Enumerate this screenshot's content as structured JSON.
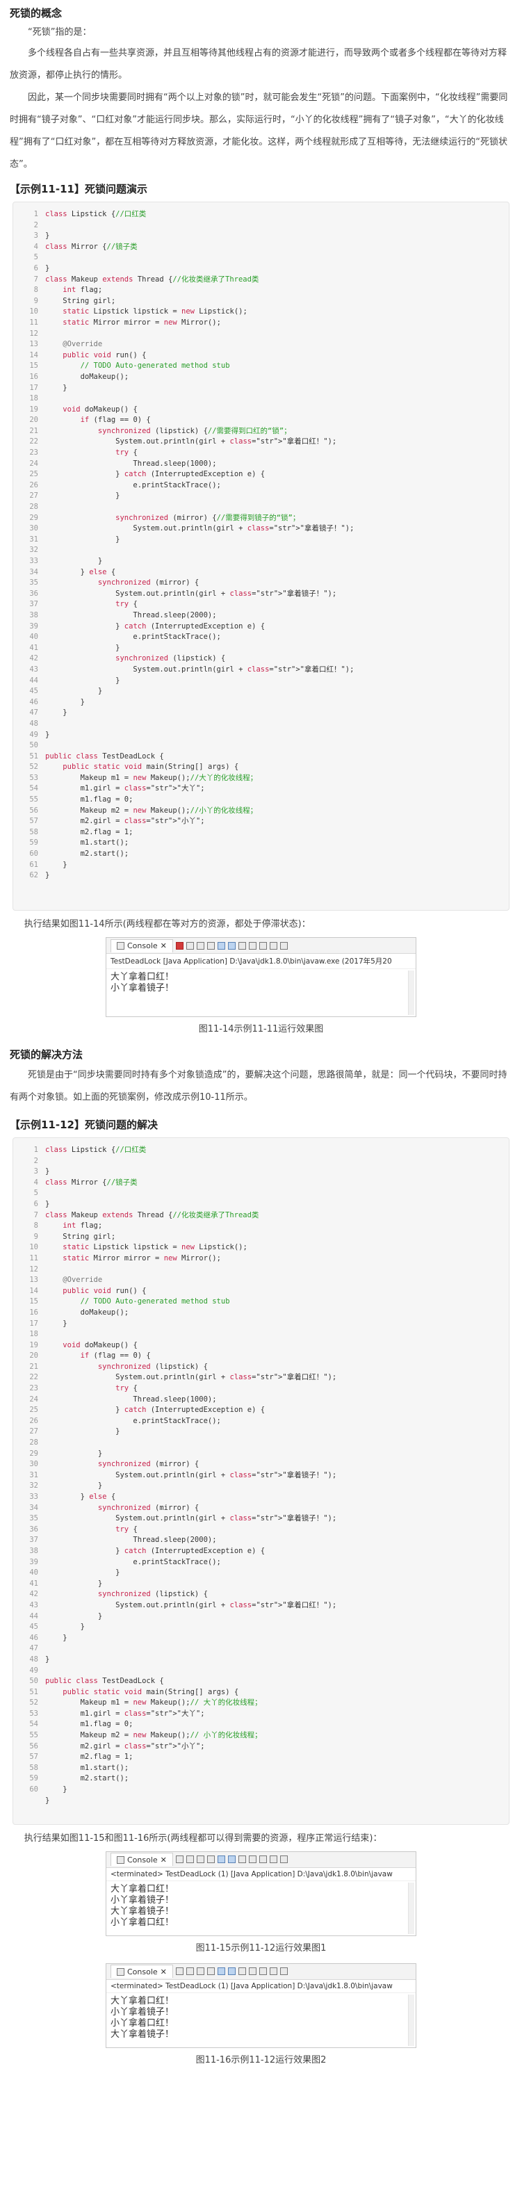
{
  "section1": {
    "title": "死锁的概念",
    "paragraphs": [
      "“死锁”指的是：",
      "多个线程各自占有一些共享资源，并且互相等待其他线程占有的资源才能进行，而导致两个或者多个线程都在等待对方释放资源，都停止执行的情形。",
      "因此，某一个同步块需要同时拥有“两个以上对象的锁”时，就可能会发生“死锁”的问题。下面案例中，“化妆线程”需要同时拥有“镜子对象”、“口红对象”才能运行同步块。那么，实际运行时，“小丫的化妆线程”拥有了“镜子对象”，“大丫的化妆线程”拥有了“口红对象”，都在互相等待对方释放资源，才能化妆。这样，两个线程就形成了互相等待，无法继续运行的“死锁状态”。"
    ]
  },
  "example1": {
    "title": "【示例11-11】死锁问题演示",
    "lines": [
      "class Lipstick {//口红类",
      "",
      "}",
      "class Mirror {//镜子类",
      "",
      "}",
      "class Makeup extends Thread {//化妆类继承了Thread类",
      "    int flag;",
      "    String girl;",
      "    static Lipstick lipstick = new Lipstick();",
      "    static Mirror mirror = new Mirror();",
      "",
      "    @Override",
      "    public void run() {",
      "        // TODO Auto-generated method stub",
      "        doMakeup();",
      "    }",
      "",
      "    void doMakeup() {",
      "        if (flag == 0) {",
      "            synchronized (lipstick) {//需要得到口红的“锁”；",
      "                System.out.println(girl + \"拿着口红！\");",
      "                try {",
      "                    Thread.sleep(1000);",
      "                } catch (InterruptedException e) {",
      "                    e.printStackTrace();",
      "                }",
      "",
      "                synchronized (mirror) {//需要得到镜子的“锁”；",
      "                    System.out.println(girl + \"拿着镜子！\");",
      "                }",
      "",
      "            }",
      "        } else {",
      "            synchronized (mirror) {",
      "                System.out.println(girl + \"拿着镜子！\");",
      "                try {",
      "                    Thread.sleep(2000);",
      "                } catch (InterruptedException e) {",
      "                    e.printStackTrace();",
      "                }",
      "                synchronized (lipstick) {",
      "                    System.out.println(girl + \"拿着口红！\");",
      "                }",
      "            }",
      "        }",
      "    }",
      "",
      "}",
      "",
      "public class TestDeadLock {",
      "    public static void main(String[] args) {",
      "        Makeup m1 = new Makeup();//大丫的化妆线程；",
      "        m1.girl = \"大丫\";",
      "        m1.flag = 0;",
      "        Makeup m2 = new Makeup();//小丫的化妆线程；",
      "        m2.girl = \"小丫\";",
      "        m2.flag = 1;",
      "        m1.start();",
      "        m2.start();",
      "    }",
      "}"
    ],
    "numbers": [
      "1",
      "2",
      "3",
      "4",
      "5",
      "6",
      "7",
      "8",
      "9",
      "10",
      "11",
      "12",
      "13",
      "14",
      "15",
      "16",
      "17",
      "18",
      "19",
      "20",
      "21",
      "22",
      "23",
      "24",
      "25",
      "26",
      "27",
      "28",
      "29",
      "30",
      "31",
      "32",
      "33",
      "34",
      "35",
      "36",
      "37",
      "38",
      "39",
      "40",
      "41",
      "42",
      "43",
      "44",
      "45",
      "46",
      "47",
      "48",
      "49",
      "50",
      "51",
      "52",
      "53",
      "54",
      "55",
      "56",
      "57",
      "58",
      "59",
      "60",
      "61",
      "62",
      "",
      ""
    ],
    "result_text": "执行结果如图11-14所示(两线程都在等对方的资源，都处于停滞状态)：",
    "console": {
      "tab": "Console",
      "header": "TestDeadLock [Java Application] D:\\Java\\jdk1.8.0\\bin\\javaw.exe (2017年5月20",
      "output": [
        "大丫拿着口红！",
        "小丫拿着镜子！"
      ]
    },
    "caption": "图11-14示例11-11运行效果图"
  },
  "section2": {
    "title": "死锁的解决方法",
    "paragraphs": [
      "死锁是由于“同步块需要同时持有多个对象锁造成”的，要解决这个问题，思路很简单，就是：同一个代码块，不要同时持有两个对象锁。如上面的死锁案例，修改成示例10-11所示。"
    ]
  },
  "example2": {
    "title": "【示例11-12】死锁问题的解决",
    "lines": [
      "class Lipstick {//口红类",
      "",
      "}",
      "class Mirror {//镜子类",
      "",
      "}",
      "class Makeup extends Thread {//化妆类继承了Thread类",
      "    int flag;",
      "    String girl;",
      "    static Lipstick lipstick = new Lipstick();",
      "    static Mirror mirror = new Mirror();",
      "",
      "    @Override",
      "    public void run() {",
      "        // TODO Auto-generated method stub",
      "        doMakeup();",
      "    }",
      "",
      "    void doMakeup() {",
      "        if (flag == 0) {",
      "            synchronized (lipstick) {",
      "                System.out.println(girl + \"拿着口红！\");",
      "                try {",
      "                    Thread.sleep(1000);",
      "                } catch (InterruptedException e) {",
      "                    e.printStackTrace();",
      "                }",
      "",
      "            }",
      "            synchronized (mirror) {",
      "                System.out.println(girl + \"拿着镜子！\");",
      "            }",
      "        } else {",
      "            synchronized (mirror) {",
      "                System.out.println(girl + \"拿着镜子！\");",
      "                try {",
      "                    Thread.sleep(2000);",
      "                } catch (InterruptedException e) {",
      "                    e.printStackTrace();",
      "                }",
      "            }",
      "            synchronized (lipstick) {",
      "                System.out.println(girl + \"拿着口红！\");",
      "            }",
      "        }",
      "    }",
      "",
      "}",
      "",
      "public class TestDeadLock {",
      "    public static void main(String[] args) {",
      "        Makeup m1 = new Makeup();// 大丫的化妆线程；",
      "        m1.girl = \"大丫\";",
      "        m1.flag = 0;",
      "        Makeup m2 = new Makeup();// 小丫的化妆线程；",
      "        m2.girl = \"小丫\";",
      "        m2.flag = 1;",
      "        m1.start();",
      "        m2.start();",
      "    }",
      "}"
    ],
    "numbers": [
      "1",
      "2",
      "3",
      "4",
      "5",
      "6",
      "7",
      "8",
      "9",
      "10",
      "11",
      "12",
      "13",
      "14",
      "15",
      "16",
      "17",
      "18",
      "19",
      "20",
      "21",
      "22",
      "23",
      "24",
      "25",
      "26",
      "27",
      "28",
      "29",
      "30",
      "31",
      "32",
      "33",
      "34",
      "35",
      "36",
      "37",
      "38",
      "39",
      "40",
      "41",
      "42",
      "43",
      "44",
      "45",
      "46",
      "47",
      "48",
      "49",
      "50",
      "51",
      "52",
      "53",
      "54",
      "55",
      "56",
      "57",
      "58",
      "59",
      "60",
      "",
      ""
    ],
    "result_text": "执行结果如图11-15和图11-16所示(两线程都可以得到需要的资源，程序正常运行结束)：",
    "console1": {
      "tab": "Console",
      "header": "<terminated> TestDeadLock (1) [Java Application] D:\\Java\\jdk1.8.0\\bin\\javaw",
      "output": [
        "大丫拿着口红！",
        "小丫拿着镜子！",
        "大丫拿着镜子！",
        "小丫拿着口红！"
      ]
    },
    "caption1": "图11-15示例11-12运行效果图1",
    "console2": {
      "tab": "Console",
      "header": "<terminated> TestDeadLock (1) [Java Application] D:\\Java\\jdk1.8.0\\bin\\javaw",
      "output": [
        "大丫拿着口红！",
        "小丫拿着镜子！",
        "小丫拿着口红！",
        "大丫拿着镜子！"
      ]
    },
    "caption2": "图11-16示例11-12运行效果图2"
  }
}
